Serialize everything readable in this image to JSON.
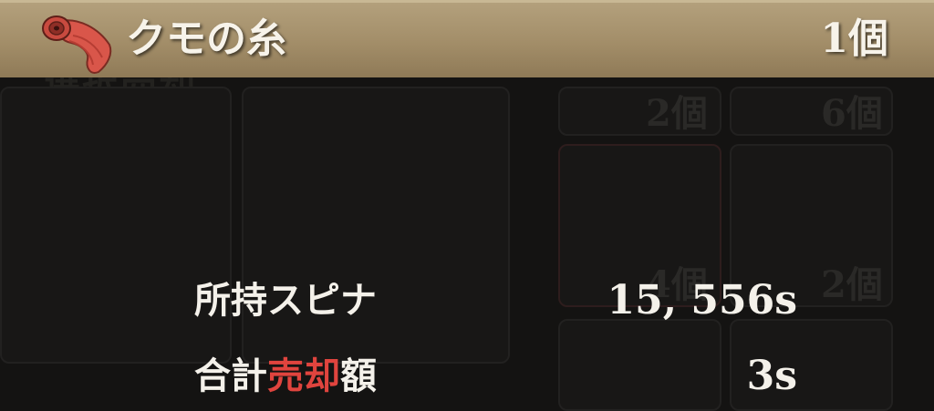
{
  "item": {
    "name": "クモの糸",
    "count": "1個",
    "icon": "silk-thread-icon",
    "icon_color": "#d9564a"
  },
  "info": {
    "owned_label": "所持スピナ",
    "owned_value": "15, 556s",
    "sale_label_pre": "合計",
    "sale_label_highlight": "売却",
    "sale_label_post": "額",
    "sale_value": "3s",
    "highlight_color": "#e0443e"
  },
  "background": {
    "counts": [
      "2個",
      "6個",
      "4個",
      "2個"
    ]
  }
}
